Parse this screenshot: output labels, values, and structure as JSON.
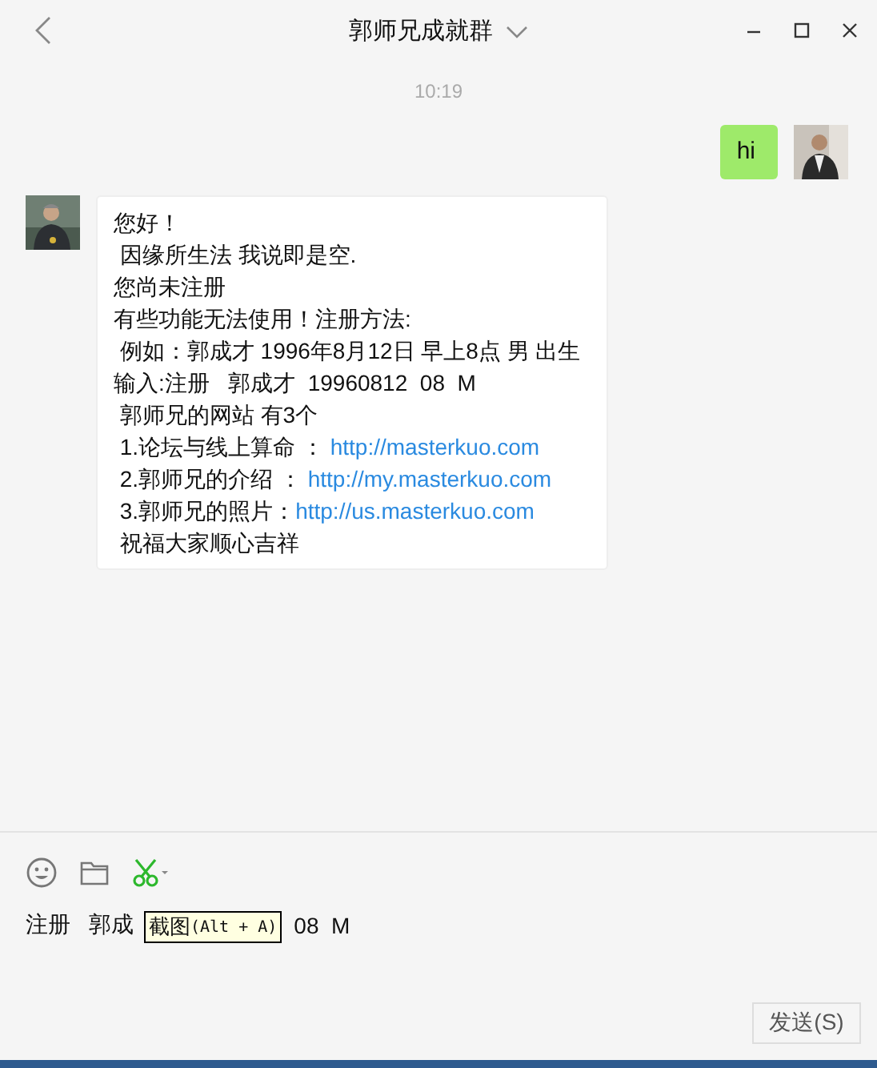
{
  "window": {
    "title": "郭师兄成就群"
  },
  "timestamp": "10:19",
  "messages": [
    {
      "kind": "sent",
      "lines": [
        {
          "text": "hi"
        }
      ]
    },
    {
      "kind": "received",
      "lines": [
        {
          "text": "您好！"
        },
        {
          "text": " 因缘所生法 我说即是空."
        },
        {
          "text": "您尚未注册"
        },
        {
          "text": "有些功能无法使用！注册方法:"
        },
        {
          "text": " 例如：郭成才 1996年8月12日 早上8点 男 出生"
        },
        {
          "text": "输入:注册   郭成才  19960812  08  M"
        },
        {
          "text": " 郭师兄的网站 有3个"
        },
        {
          "text": " 1.论坛与线上算命 ： ",
          "link": "http://masterkuo.com"
        },
        {
          "text": " 2.郭师兄的介绍 ： ",
          "link": "http://my.masterkuo.com"
        },
        {
          "text": " 3.郭师兄的照片：",
          "link": "http://us.masterkuo.com"
        },
        {
          "text": " 祝福大家顺心吉祥"
        }
      ]
    }
  ],
  "input": {
    "value_before": "注册   郭成",
    "value_after": "08  M"
  },
  "tooltip": {
    "label": "截图",
    "shortcut": "(Alt + A)"
  },
  "send_button": "发送(S)"
}
